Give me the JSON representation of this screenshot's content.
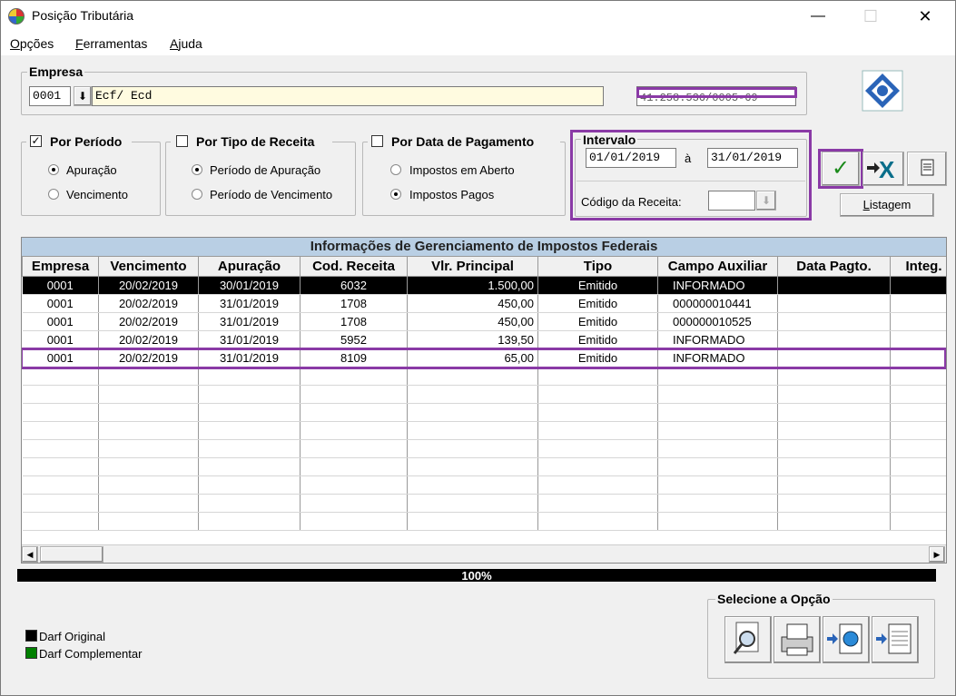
{
  "window": {
    "title": "Posição Tributária",
    "minimize": "—",
    "maximize": "☐",
    "close": "✕"
  },
  "menu": [
    {
      "label": "Opções",
      "key": "O",
      "rest": "pções"
    },
    {
      "label": "Ferramentas",
      "key": "F",
      "rest": "erramentas"
    },
    {
      "label": "Ajuda",
      "key": "A",
      "rest": "juda"
    }
  ],
  "empresa": {
    "legend": "Empresa",
    "code": "0001",
    "dropdown_glyph": "⬇",
    "name": "Ecf/ Ecd",
    "cnpj": "41.258.536/0005-69"
  },
  "por_periodo": {
    "label": "Por Período",
    "checked": true,
    "check_glyph": "✓",
    "options": [
      "Apuração",
      "Vencimento"
    ],
    "selected": 0
  },
  "por_tipo": {
    "label": "Por Tipo de Receita",
    "checked": false,
    "options": [
      "Período de Apuração",
      "Período de Vencimento"
    ],
    "selected": 0
  },
  "por_data": {
    "label": "Por Data de Pagamento",
    "checked": false,
    "options": [
      "Impostos em Aberto",
      "Impostos Pagos"
    ],
    "selected": 1
  },
  "intervalo": {
    "legend": "Intervalo",
    "from": "01/01/2019",
    "sep": "à",
    "to": "31/01/2019",
    "codigo_label": "Código da Receita:",
    "codigo_value": "",
    "codigo_glyph": "⬇"
  },
  "actions": {
    "confirm_glyph": "✓",
    "listagem": "Listagem",
    "listagem_key": "L",
    "listagem_rest": "istagem"
  },
  "grid": {
    "caption": "Informações de Gerenciamento de Impostos Federais",
    "columns": [
      "Empresa",
      "Vencimento",
      "Apuração",
      "Cod. Receita",
      "Vlr. Principal",
      "Tipo",
      "Campo Auxiliar",
      "Data Pagto.",
      "Integ."
    ],
    "rows": [
      [
        "0001",
        "20/02/2019",
        "30/01/2019",
        "6032",
        "1.500,00",
        "Emitido",
        "INFORMADO",
        "",
        ""
      ],
      [
        "0001",
        "20/02/2019",
        "31/01/2019",
        "1708",
        "450,00",
        "Emitido",
        "000000010441",
        "",
        ""
      ],
      [
        "0001",
        "20/02/2019",
        "31/01/2019",
        "1708",
        "450,00",
        "Emitido",
        "000000010525",
        "",
        ""
      ],
      [
        "0001",
        "20/02/2019",
        "31/01/2019",
        "5952",
        "139,50",
        "Emitido",
        "INFORMADO",
        "",
        ""
      ],
      [
        "0001",
        "20/02/2019",
        "31/01/2019",
        "8109",
        "65,00",
        "Emitido",
        "INFORMADO",
        "",
        ""
      ]
    ],
    "selected_row": 0,
    "highlighted_row": 4,
    "scroll_left": "◀",
    "scroll_right": "▶"
  },
  "progress": {
    "text": "100%",
    "value": 1.0
  },
  "legend": {
    "original": "Darf Original",
    "complementar": "Darf Complementar",
    "original_color": "#000000",
    "complementar_color": "#008000"
  },
  "opcoes": {
    "legend": "Selecione a Opção",
    "buttons": [
      "search-icon",
      "printer-icon",
      "export-globe-icon",
      "export-document-icon"
    ]
  },
  "colors": {
    "highlight": "#8a3aa6",
    "grid_caption": "#b9cfe4"
  }
}
